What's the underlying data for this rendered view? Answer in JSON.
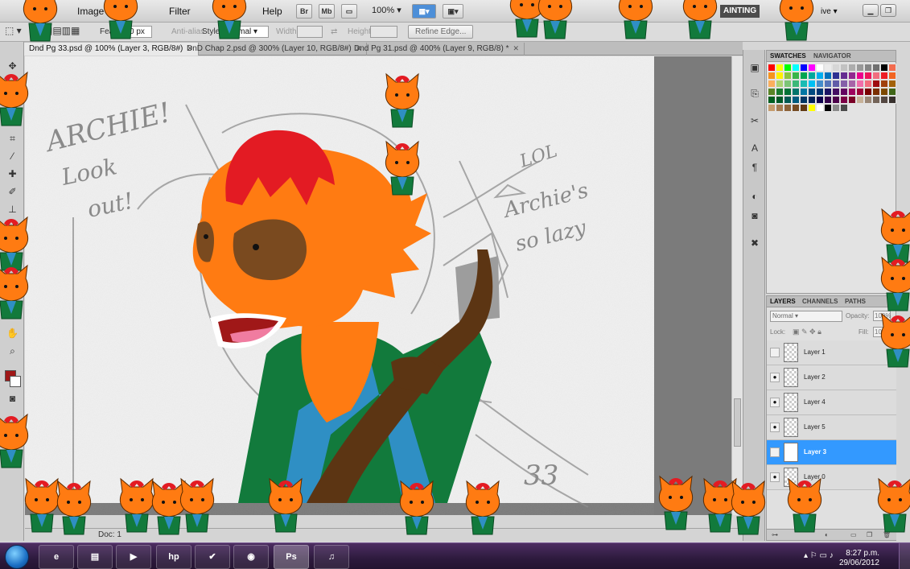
{
  "menubar": {
    "items": [
      "Image",
      "Filter",
      "Help"
    ],
    "app_buttons": [
      "Br",
      "Mb"
    ],
    "zoom": "100%",
    "workspace": "AINTING",
    "workspace_tail": "ive",
    "window_controls": [
      "minimize",
      "restore",
      "close"
    ]
  },
  "options": {
    "feather_label": "Feather:",
    "feather_value": "0 px",
    "antialias_label": "Anti-alias",
    "style_label": "Style:",
    "style_value": "Normal",
    "width_label": "Width:",
    "height_label": "Height:",
    "refine_label": "Refine Edge..."
  },
  "tabs": [
    {
      "label": "Dnd Pg 33.psd @ 100% (Layer 3, RGB/8#)",
      "active": true
    },
    {
      "label": "DnD Chap 2.psd @ 300% (Layer 10, RGB/8#)",
      "active": false
    },
    {
      "label": "Dnd Pg 31.psd @ 400% (Layer 9, RGB/8) *",
      "active": false
    }
  ],
  "tab_close_glyph": "✕",
  "status": {
    "doc_info": "Doc: 1"
  },
  "swatches_panel": {
    "tabs": [
      "SWATCHES",
      "NAVIGATOR"
    ]
  },
  "layers_panel": {
    "tabs": [
      "LAYERS",
      "CHANNELS",
      "PATHS"
    ],
    "blend_mode": "Normal",
    "opacity_label": "Opacity:",
    "opacity_value": "100%",
    "lock_label": "Lock:",
    "fill_label": "Fill:",
    "fill_value": "100%",
    "layers": [
      {
        "name": "Layer 1",
        "visible": false,
        "selected": false
      },
      {
        "name": "Layer 2",
        "visible": true,
        "selected": false
      },
      {
        "name": "Layer 4",
        "visible": true,
        "selected": false
      },
      {
        "name": "Layer 5",
        "visible": true,
        "selected": false
      },
      {
        "name": "Layer 3",
        "visible": false,
        "selected": true
      },
      {
        "name": "Layer 0",
        "visible": true,
        "selected": false
      }
    ]
  },
  "taskbar": {
    "apps": [
      {
        "name": "internet-explorer",
        "glyph": "e"
      },
      {
        "name": "file-explorer",
        "glyph": "▤"
      },
      {
        "name": "media-player",
        "glyph": "▶"
      },
      {
        "name": "hp",
        "glyph": "hp"
      },
      {
        "name": "checkmark-app",
        "glyph": "✔"
      },
      {
        "name": "firefox",
        "glyph": "◉"
      },
      {
        "name": "photoshop",
        "glyph": "Ps"
      },
      {
        "name": "itunes",
        "glyph": "♫"
      }
    ],
    "time": "8:27 p.m.",
    "date": "29/06/2012"
  },
  "canvas_text": {
    "archie": "ARCHIE!",
    "look": "Look",
    "out": "out!",
    "lol": "LOL",
    "archies": "Archie's",
    "so_lazy": "so lazy",
    "page_number": "33"
  },
  "colors": {
    "fur_orange": "#ff7b12",
    "hair_red": "#e31b23",
    "mask_brown": "#7a4a1f",
    "shirt_green": "#127a3c",
    "strap_blue": "#2f8fc4",
    "strap_brown": "#5c3513",
    "mouth_red": "#a01818",
    "selection_blue": "#3399ff"
  }
}
